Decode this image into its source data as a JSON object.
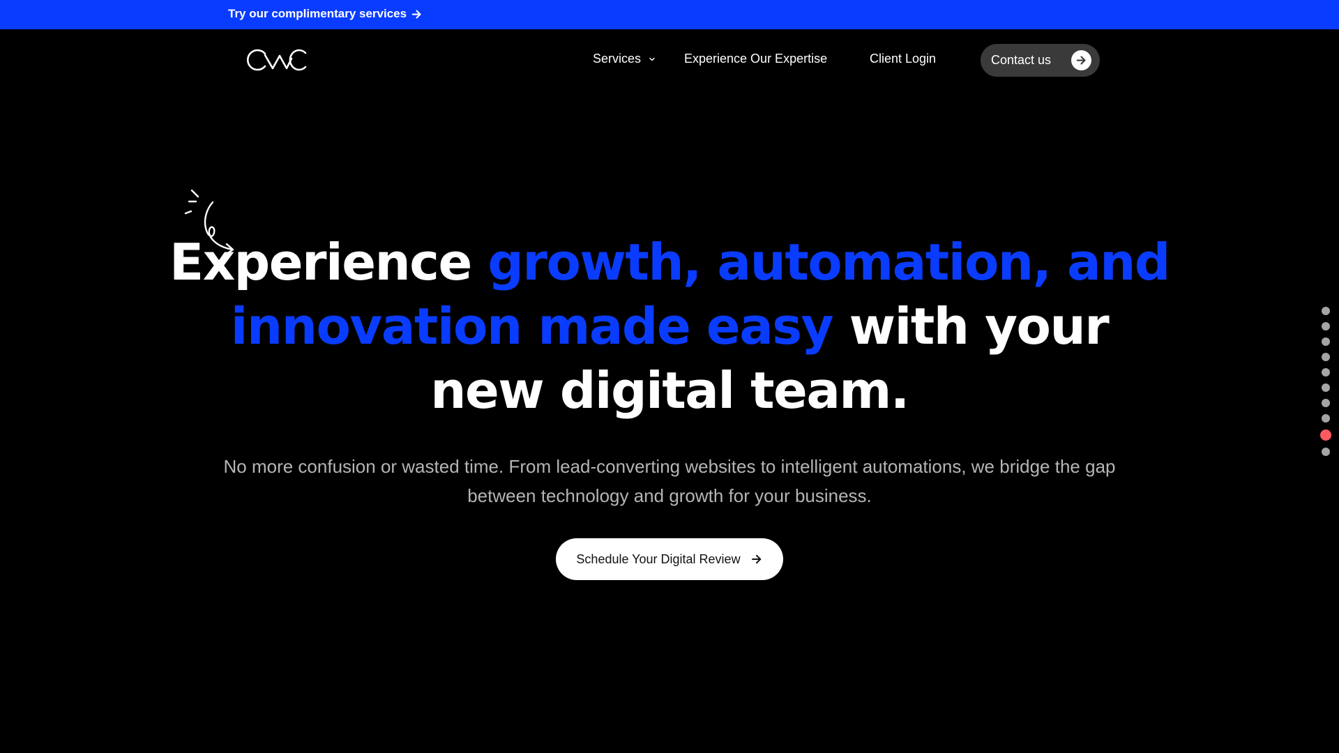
{
  "promo": {
    "text": "Try our complimentary services",
    "icon": "arrow-right-icon",
    "background": "#0a3cff"
  },
  "nav": {
    "logo": "OWC",
    "services_label": "Services",
    "expertise_label": "Experience Our Expertise",
    "login_label": "Client Login",
    "contact_label": "Contact us"
  },
  "hero": {
    "heading_white_1": "Experience ",
    "heading_blue": "growth, automation, and innovation made easy",
    "heading_white_2": " with your new digital team.",
    "subheading": "No more confusion or wasted time. From lead-converting websites to intelligent automations, we bridge the gap between technology and growth for your business.",
    "cta_label": "Schedule Your Digital Review",
    "accent_color": "#0a3cff"
  },
  "section_dots": {
    "count": 10,
    "active_index": 8,
    "active_color": "#ff5a5f",
    "inactive_color": "#a5a5a5"
  }
}
